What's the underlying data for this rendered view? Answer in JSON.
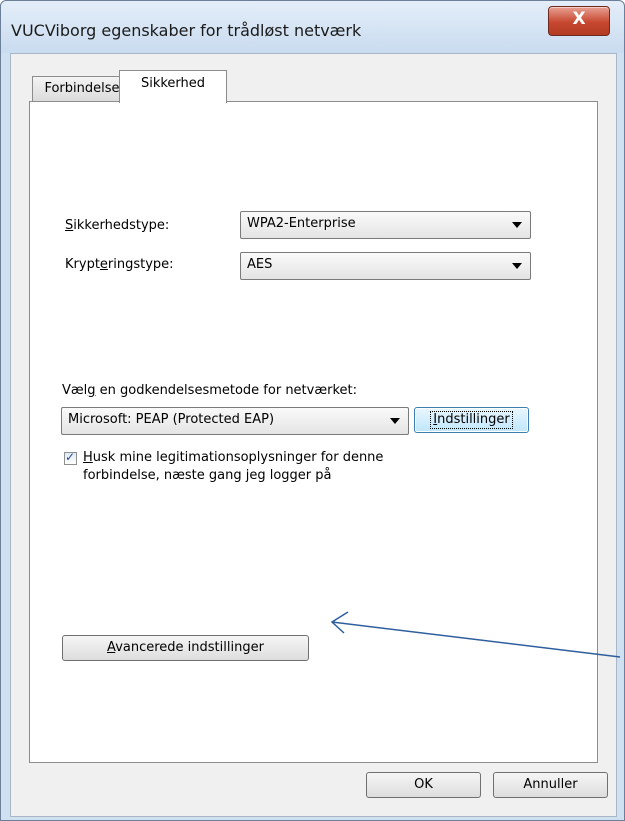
{
  "window": {
    "title": "VUCViborg egenskaber for trådløst netværk",
    "close_icon": "close-icon",
    "close_glyph": "X"
  },
  "tabs": [
    {
      "label": "Forbindelse",
      "selected": false
    },
    {
      "label": "Sikkerhed",
      "selected": true
    }
  ],
  "security": {
    "type_label_pre": "",
    "type_label_u": "S",
    "type_label_post": "ikkerhedstype:",
    "type_value": "WPA2-Enterprise",
    "enc_label_pre": "Krypt",
    "enc_label_u": "e",
    "enc_label_post": "ringstype:",
    "enc_value": "AES"
  },
  "auth": {
    "label_pre": "Væl",
    "label_u": "g",
    "label_post": " en godkendelsesmetode for netværket:",
    "method_value": "Microsoft: PEAP (Protected EAP)",
    "settings_button_u": "I",
    "settings_button_rest": "ndstillinger"
  },
  "remember": {
    "checked": true,
    "check_glyph": "✓",
    "line1_u": "H",
    "line1_rest": "usk mine legitimationsoplysninger for denne",
    "line2": "forbindelse, næste gang jeg logger på"
  },
  "advanced": {
    "button_u": "A",
    "button_rest": "vancerede indstillinger"
  },
  "footer": {
    "ok_label": "OK",
    "cancel_label": "Annuller"
  },
  "colors": {
    "annotation_arrow": "#2e5e9e",
    "close_button": "#c7472f"
  }
}
